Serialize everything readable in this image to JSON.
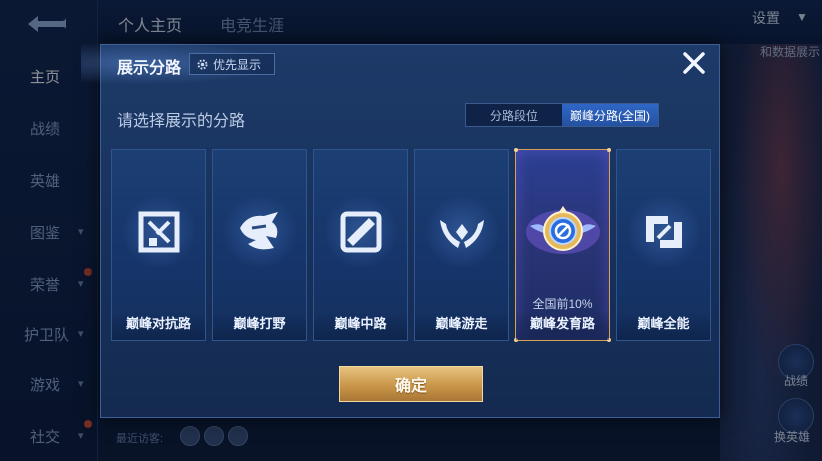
{
  "background": {
    "sidebar": {
      "items": [
        {
          "label": "主页",
          "active": true
        },
        {
          "label": "战绩"
        },
        {
          "label": "英雄"
        },
        {
          "label": "图鉴"
        },
        {
          "label": "荣誉"
        },
        {
          "label": "护卫队"
        },
        {
          "label": "游戏"
        },
        {
          "label": "社交"
        }
      ]
    },
    "top_tabs": [
      {
        "label": "个人主页",
        "active": true
      },
      {
        "label": "电竞生涯"
      }
    ],
    "settings_label": "设置",
    "stats_label": "和数据展示",
    "visitors_label": "最近访客:",
    "right_labels": [
      "战绩",
      "换英雄"
    ]
  },
  "modal": {
    "title": "展示分路",
    "priority_label": "优先显示",
    "subtitle": "请选择展示的分路",
    "segments": [
      {
        "label": "分路段位",
        "active": false
      },
      {
        "label": "巅峰分路(全国)",
        "active": true
      }
    ],
    "lanes": [
      {
        "label": "巅峰对抗路",
        "icon": "sword-crossed-icon"
      },
      {
        "label": "巅峰打野",
        "icon": "dragon-icon"
      },
      {
        "label": "巅峰中路",
        "icon": "staff-icon"
      },
      {
        "label": "巅峰游走",
        "icon": "wings-icon"
      },
      {
        "label": "巅峰发育路",
        "icon": "golden-target-badge-icon",
        "selected": true,
        "rank": "全国前10%"
      },
      {
        "label": "巅峰全能",
        "icon": "interlock-icon"
      }
    ],
    "confirm_label": "确定"
  },
  "colors": {
    "accent_gold": "#d6a256",
    "segment_active": "#2f67c6",
    "modal_bg": "#1d3a68"
  }
}
